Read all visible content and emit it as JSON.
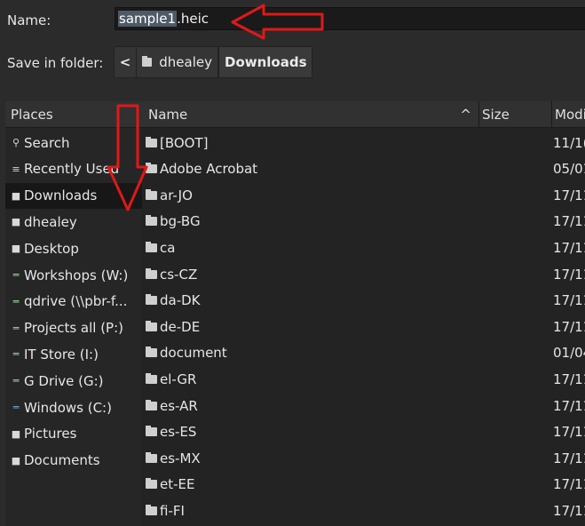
{
  "dialog": {
    "name_label": "Name:",
    "filename_selected": "sample1",
    "filename_ext": ".heic",
    "save_in_label": "Save in folder:",
    "breadcrumb_back": "<",
    "breadcrumb": [
      "dhealey",
      "Downloads"
    ]
  },
  "places": {
    "header": "Places",
    "items": [
      {
        "label": "Search",
        "icon": "search-icon"
      },
      {
        "label": "Recently Used",
        "icon": "recent-icon"
      },
      {
        "label": "Downloads",
        "icon": "folder-icon",
        "selected": true
      },
      {
        "label": "dhealey",
        "icon": "folder-icon"
      },
      {
        "label": "Desktop",
        "icon": "folder-icon"
      },
      {
        "label": "Workshops (W:)",
        "icon": "network-drive-icon"
      },
      {
        "label": "qdrive (\\\\pbr-f...",
        "icon": "network-drive-icon"
      },
      {
        "label": "Projects all (P:)",
        "icon": "network-drive-icon"
      },
      {
        "label": "IT Store (I:)",
        "icon": "network-drive-icon"
      },
      {
        "label": "G Drive (G:)",
        "icon": "network-drive-icon"
      },
      {
        "label": "Windows (C:)",
        "icon": "drive-icon"
      },
      {
        "label": "Pictures",
        "icon": "folder-icon"
      },
      {
        "label": "Documents",
        "icon": "folder-icon"
      }
    ]
  },
  "files": {
    "columns": {
      "name": "Name",
      "sort_indicator": "^",
      "size": "Size",
      "modified": "Modi"
    },
    "rows": [
      {
        "name": "[BOOT]",
        "modified": "11/1("
      },
      {
        "name": "Adobe Acrobat",
        "modified": "05/01"
      },
      {
        "name": "ar-JO",
        "modified": "17/11"
      },
      {
        "name": "bg-BG",
        "modified": "17/11"
      },
      {
        "name": "ca",
        "modified": "17/11"
      },
      {
        "name": "cs-CZ",
        "modified": "17/11"
      },
      {
        "name": "da-DK",
        "modified": "17/11"
      },
      {
        "name": "de-DE",
        "modified": "17/11"
      },
      {
        "name": "document",
        "modified": "01/04"
      },
      {
        "name": "el-GR",
        "modified": "17/11"
      },
      {
        "name": "es-AR",
        "modified": "17/11"
      },
      {
        "name": "es-ES",
        "modified": "17/11"
      },
      {
        "name": "es-MX",
        "modified": "17/11"
      },
      {
        "name": "et-EE",
        "modified": "17/11"
      },
      {
        "name": "fi-FI",
        "modified": "17/11"
      }
    ]
  },
  "annotation_color": "#e01818"
}
